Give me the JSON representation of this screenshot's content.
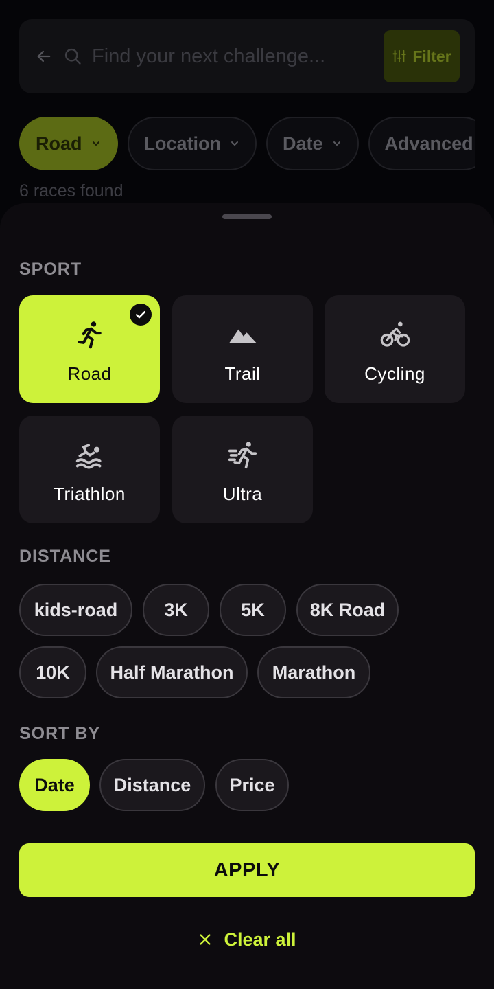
{
  "search": {
    "placeholder": "Find your next challenge...",
    "filter_label": "Filter"
  },
  "top_filters": [
    {
      "label": "Road",
      "active": true
    },
    {
      "label": "Location",
      "active": false
    },
    {
      "label": "Date",
      "active": false
    },
    {
      "label": "Advanced",
      "active": false
    }
  ],
  "results_count": "6 races found",
  "sheet": {
    "sport_title": "SPORT",
    "sports": [
      {
        "label": "Road",
        "icon": "running-icon",
        "selected": true
      },
      {
        "label": "Trail",
        "icon": "mountain-icon",
        "selected": false
      },
      {
        "label": "Cycling",
        "icon": "cycling-icon",
        "selected": false
      },
      {
        "label": "Triathlon",
        "icon": "swimming-icon",
        "selected": false
      },
      {
        "label": "Ultra",
        "icon": "sprint-icon",
        "selected": false
      }
    ],
    "distance_title": "DISTANCE",
    "distances": [
      "kids-road",
      "3K",
      "5K",
      "8K Road",
      "10K",
      "Half Marathon",
      "Marathon"
    ],
    "sort_title": "SORT BY",
    "sort_options": [
      {
        "label": "Date",
        "active": true
      },
      {
        "label": "Distance",
        "active": false
      },
      {
        "label": "Price",
        "active": false
      }
    ],
    "apply_label": "APPLY",
    "clear_label": "Clear all"
  },
  "colors": {
    "accent": "#CDF23A",
    "card_bg": "#1B181D",
    "sheet_bg": "#0D0B0F",
    "page_bg": "#050508"
  }
}
